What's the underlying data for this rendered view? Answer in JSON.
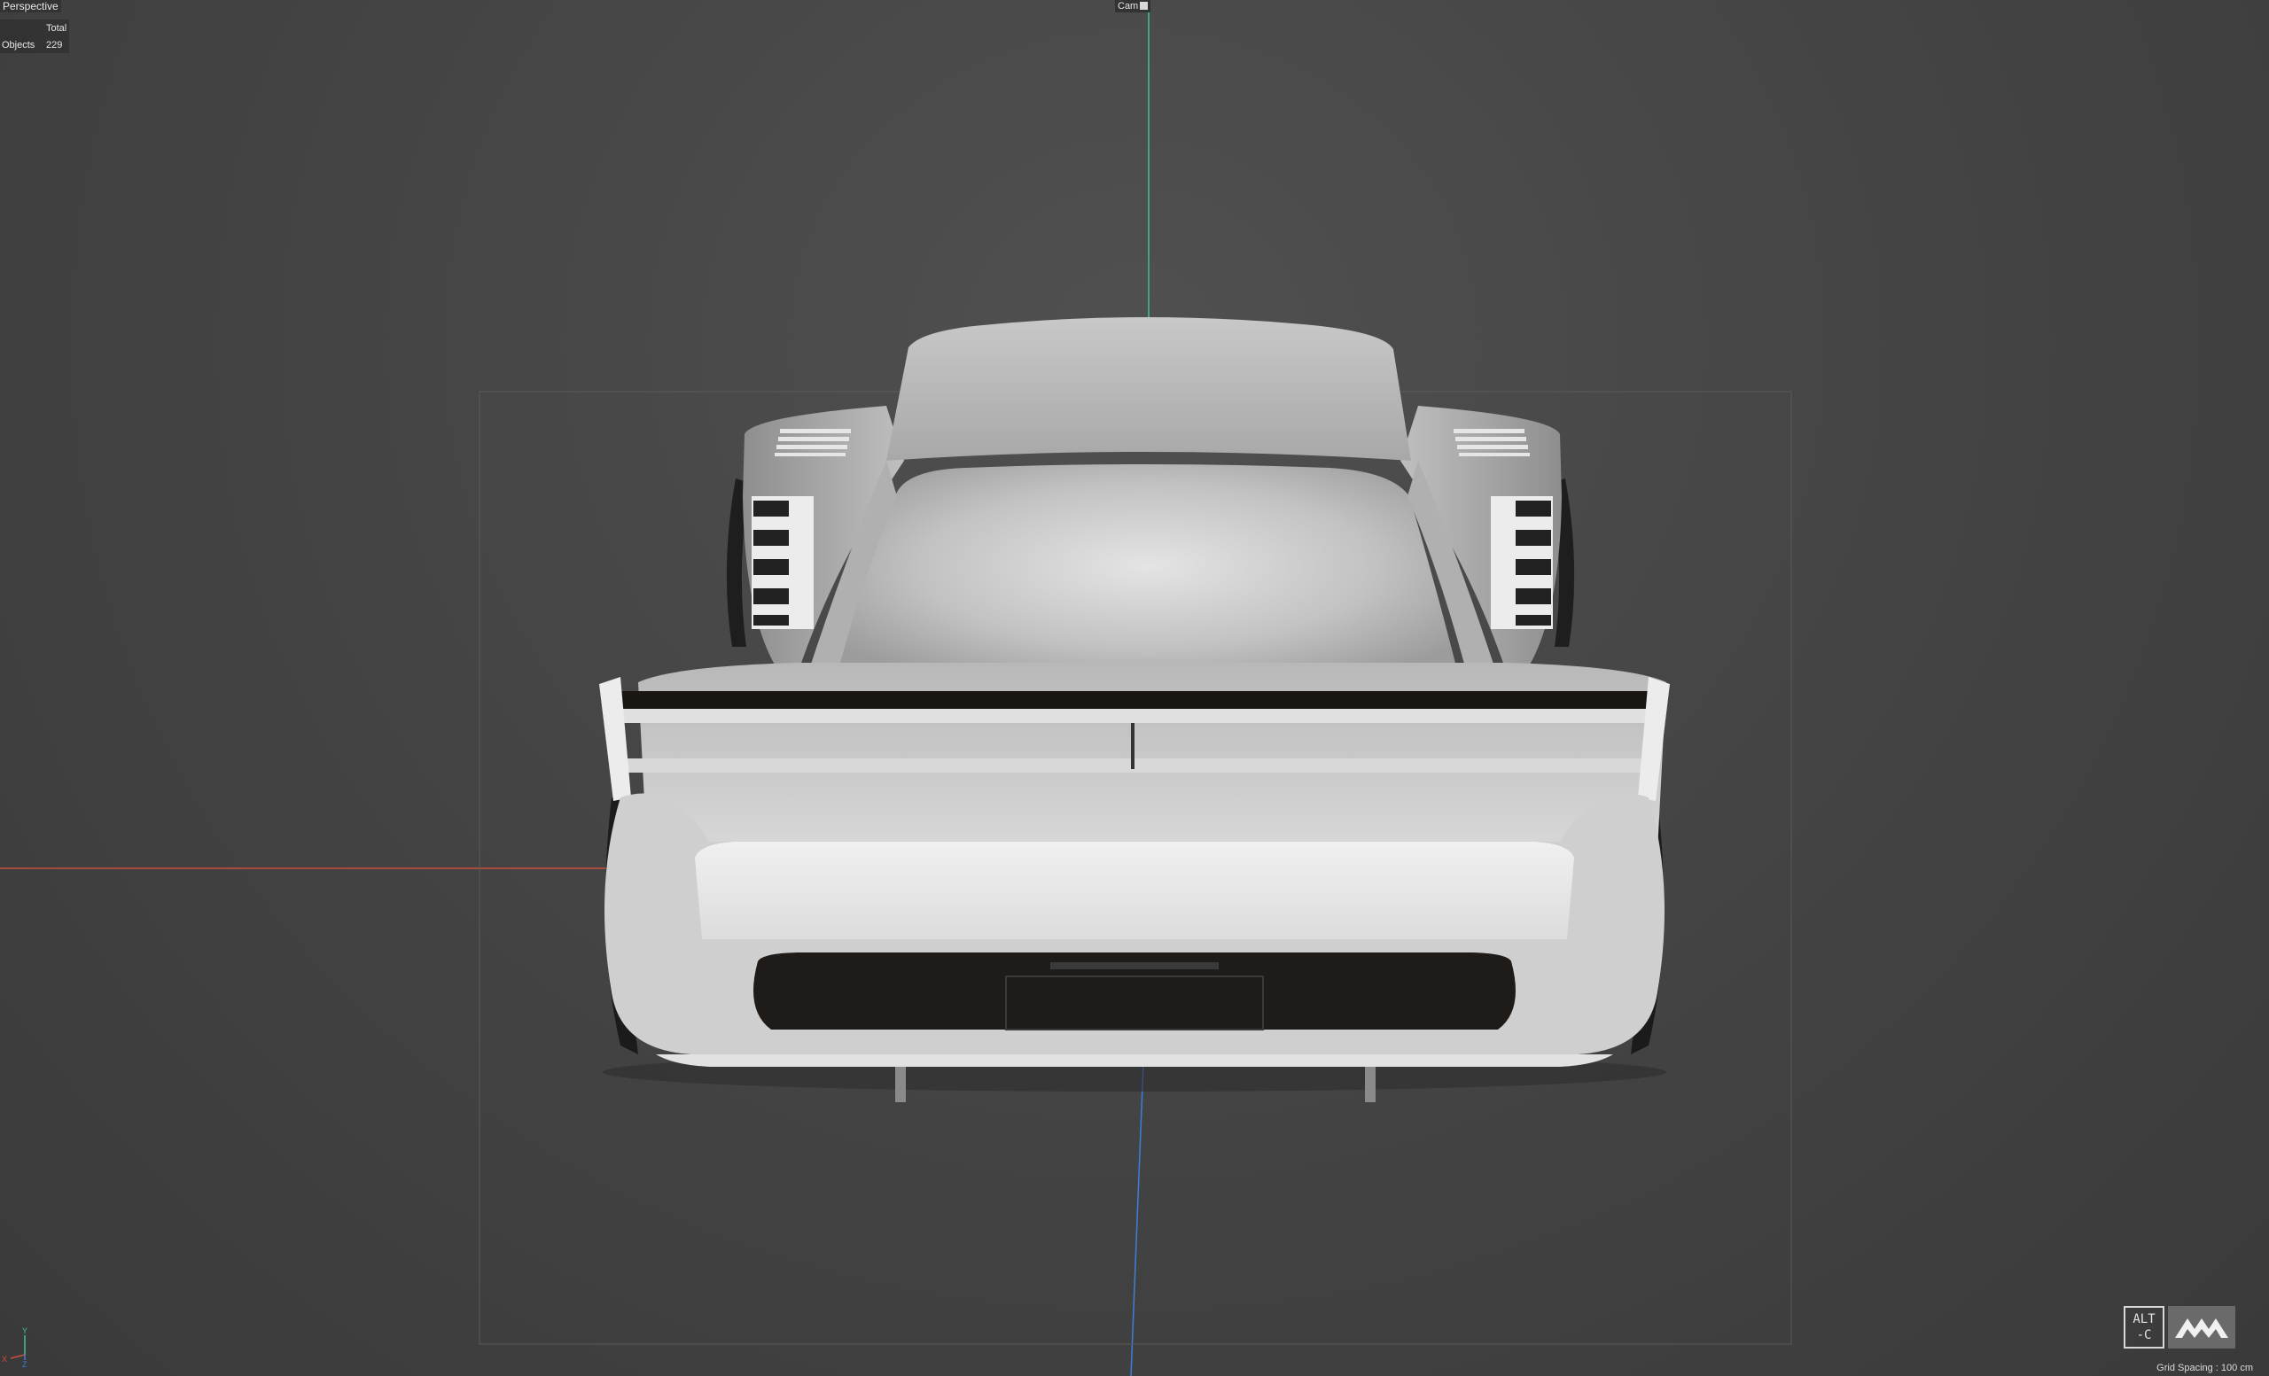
{
  "viewport": {
    "view_name": "Perspective",
    "camera_label": "Cam",
    "grid_spacing": "Grid Spacing : 100 cm"
  },
  "stats": {
    "column_header": "Total",
    "rows": [
      {
        "label": "Objects",
        "value": "229"
      }
    ]
  },
  "axis_gizmo": {
    "y_label": "Y",
    "x_label": "X",
    "z_label": "Z"
  },
  "branding": {
    "altc_text_line1": "ALT",
    "altc_text_line2": "-C"
  },
  "colors": {
    "x_axis": "#c9503c",
    "y_axis": "#3fc48a",
    "z_axis": "#3d7fd6",
    "car_body": "#d6d6d6",
    "background": "#454545"
  },
  "scene": {
    "icon": "car-rear-model"
  }
}
